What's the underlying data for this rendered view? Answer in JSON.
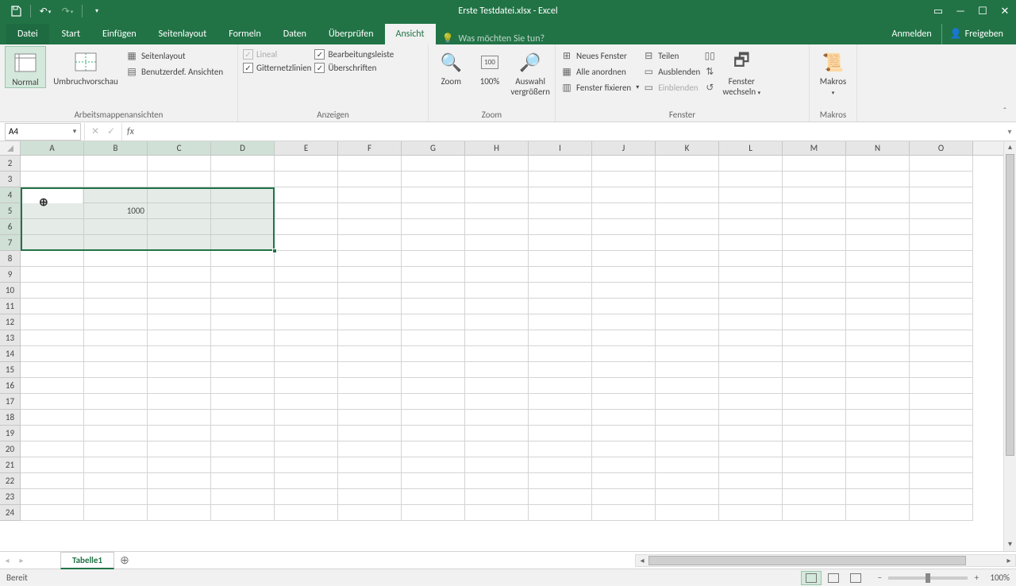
{
  "title": "Erste Testdatei.xlsx - Excel",
  "qat": {
    "save": "save",
    "undo": "↶",
    "redo": "↷"
  },
  "window_controls": {
    "ribbon_opts": "▭",
    "minimize": "—",
    "maximize": "☐",
    "close": "✕"
  },
  "tabs": {
    "datei": "Datei",
    "items": [
      "Start",
      "Einfügen",
      "Seitenlayout",
      "Formeln",
      "Daten",
      "Überprüfen",
      "Ansicht"
    ],
    "active": "Ansicht",
    "tell_me": "Was möchten Sie tun?",
    "signin": "Anmelden",
    "share": "Freigeben"
  },
  "ribbon": {
    "views": {
      "normal": "Normal",
      "umbruch": "Umbruchvorschau",
      "seitenlayout": "Seitenlayout",
      "benutzer": "Benutzerdef. Ansichten",
      "label": "Arbeitsmappenansichten"
    },
    "show": {
      "lineal": "Lineal",
      "gitter": "Gitternetzlinien",
      "bearb": "Bearbeitungsleiste",
      "uber": "Überschriften",
      "label": "Anzeigen"
    },
    "zoom": {
      "zoom": "Zoom",
      "hundred": "100%",
      "auswahl1": "Auswahl",
      "auswahl2": "vergrößern",
      "label": "Zoom"
    },
    "window": {
      "neues": "Neues Fenster",
      "alle": "Alle anordnen",
      "fix": "Fenster fixieren",
      "teilen": "Teilen",
      "ausblenden": "Ausblenden",
      "einblenden": "Einblenden",
      "wechseln1": "Fenster",
      "wechseln2": "wechseln",
      "label": "Fenster"
    },
    "makros": {
      "makros": "Makros",
      "label": "Makros"
    }
  },
  "name_box": "A4",
  "formula": "",
  "columns": [
    "A",
    "B",
    "C",
    "D",
    "E",
    "F",
    "G",
    "H",
    "I",
    "J",
    "K",
    "L",
    "M",
    "N",
    "O"
  ],
  "rows": [
    2,
    3,
    4,
    5,
    6,
    7,
    8,
    9,
    10,
    11,
    12,
    13,
    14,
    15,
    16,
    17,
    18,
    19,
    20,
    21,
    22,
    23,
    24
  ],
  "selected_cols": [
    "A",
    "B",
    "C",
    "D"
  ],
  "selected_rows": [
    4,
    5,
    6,
    7
  ],
  "active_cell": "A4",
  "cell_B5": "1000",
  "sheet_tabs": {
    "active": "Tabelle1"
  },
  "status": {
    "ready": "Bereit",
    "zoom": "100%"
  },
  "chart_data": {
    "type": "table",
    "note": "Spreadsheet selection A4:D7; cell B5 contains 1000; other visible cells empty.",
    "cells": {
      "B5": 1000
    },
    "selection": "A4:D7",
    "active": "A4"
  }
}
